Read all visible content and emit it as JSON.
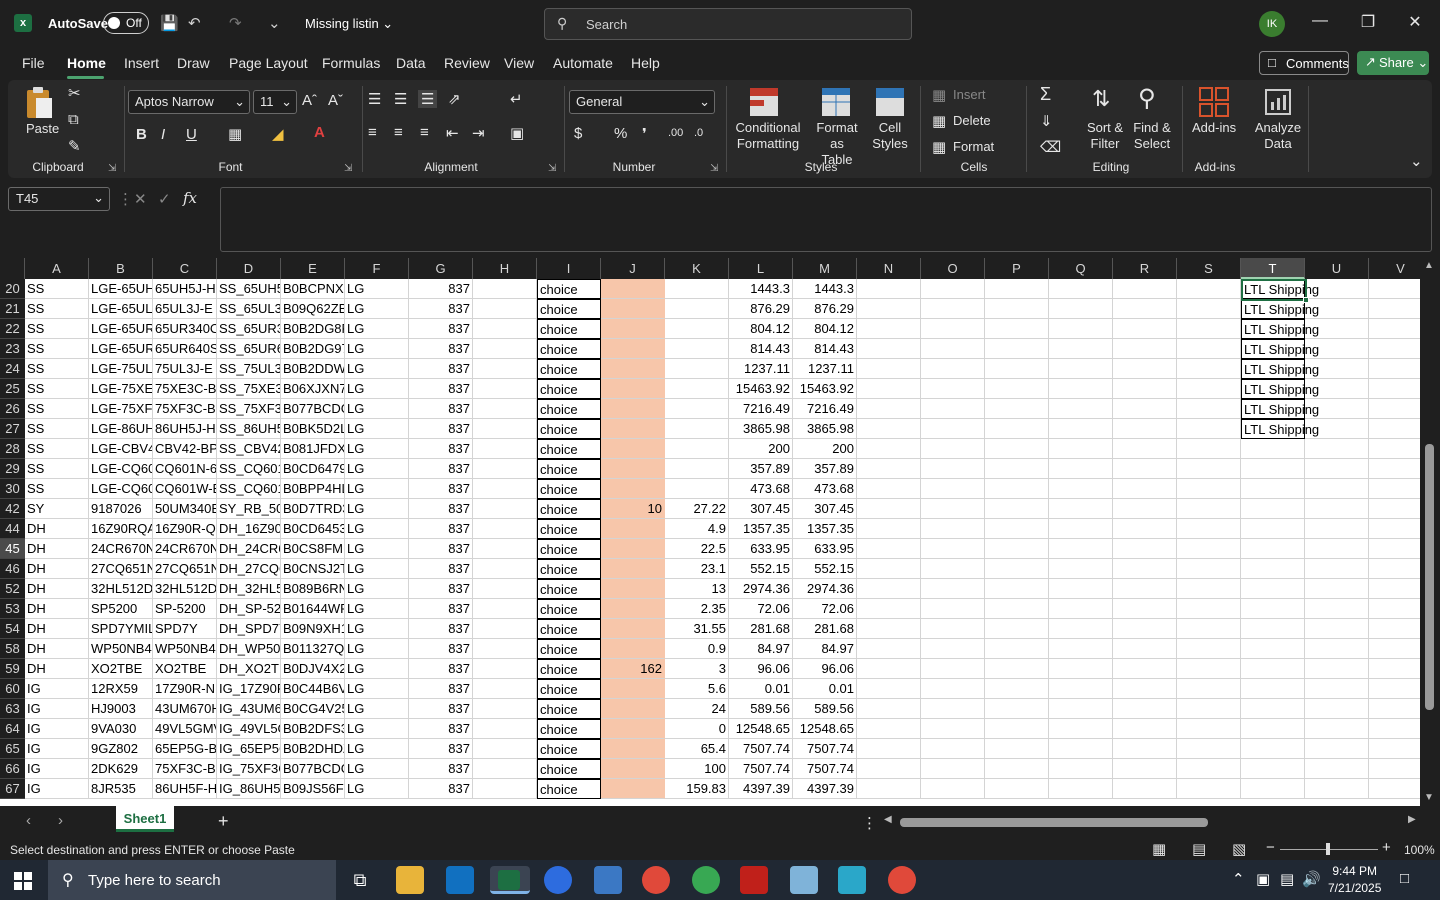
{
  "titlebar": {
    "autosave_label": "AutoSave",
    "autosave_state": "Off",
    "document_title": "Missing listin",
    "search_placeholder": "Search",
    "user_initials": "IK"
  },
  "menu": {
    "tabs": [
      "File",
      "Home",
      "Insert",
      "Draw",
      "Page Layout",
      "Formulas",
      "Data",
      "Review",
      "View",
      "Automate",
      "Help"
    ],
    "active": "Home",
    "comments_label": "Comments",
    "share_label": "Share"
  },
  "ribbon": {
    "clipboard": {
      "paste": "Paste",
      "group": "Clipboard"
    },
    "font": {
      "family": "Aptos Narrow",
      "size": "11",
      "group": "Font",
      "bold": "B",
      "italic": "I",
      "underline": "U"
    },
    "alignment": {
      "group": "Alignment"
    },
    "number": {
      "format": "General",
      "group": "Number"
    },
    "styles": {
      "conditional": "Conditional\nFormatting",
      "format_table": "Format as\nTable",
      "cell_styles": "Cell\nStyles",
      "group": "Styles"
    },
    "cells": {
      "insert": "Insert",
      "delete": "Delete",
      "format": "Format",
      "group": "Cells"
    },
    "editing": {
      "sort_filter": "Sort &\nFilter",
      "find_select": "Find &\nSelect",
      "group": "Editing"
    },
    "addins": {
      "addins": "Add-ins",
      "analyze": "Analyze\nData",
      "group": "Add-ins"
    }
  },
  "formula_bar": {
    "name_box": "T45",
    "fx": "fx",
    "value": ""
  },
  "columns": [
    "A",
    "B",
    "C",
    "D",
    "E",
    "F",
    "G",
    "H",
    "I",
    "J",
    "K",
    "L",
    "M",
    "N",
    "O",
    "P",
    "Q",
    "R",
    "S",
    "T",
    "U",
    "V"
  ],
  "selected_column": "T",
  "selected_row": "45",
  "rows": [
    {
      "n": "20",
      "A": "SS",
      "B": "LGE-65UH5",
      "C": "65UH5J-H",
      "D": "SS_65UH5.",
      "E": "B0BCPNXN",
      "F": "LG",
      "G": "837",
      "I": "choice",
      "J": "",
      "K": "",
      "L": "1443.3",
      "M": "1443.3",
      "T": "LTL Shipping"
    },
    {
      "n": "21",
      "A": "SS",
      "B": "LGE-65UL3",
      "C": "65UL3J-E",
      "D": "SS_65UL3J",
      "E": "B09Q62ZB",
      "F": "LG",
      "G": "837",
      "I": "choice",
      "J": "",
      "K": "",
      "L": "876.29",
      "M": "876.29",
      "T": "LTL Shipping"
    },
    {
      "n": "22",
      "A": "SS",
      "B": "LGE-65UR3",
      "C": "65UR340C",
      "D": "SS_65UR34",
      "E": "B0B2DG8P",
      "F": "LG",
      "G": "837",
      "I": "choice",
      "J": "",
      "K": "",
      "L": "804.12",
      "M": "804.12",
      "T": "LTL Shipping"
    },
    {
      "n": "23",
      "A": "SS",
      "B": "LGE-65UR6",
      "C": "65UR640S",
      "D": "SS_65UR64",
      "E": "B0B2DG97",
      "F": "LG",
      "G": "837",
      "I": "choice",
      "J": "",
      "K": "",
      "L": "814.43",
      "M": "814.43",
      "T": "LTL Shipping"
    },
    {
      "n": "24",
      "A": "SS",
      "B": "LGE-75UL3",
      "C": "75UL3J-E",
      "D": "SS_75UL3J",
      "E": "B0B2DDW",
      "F": "LG",
      "G": "837",
      "I": "choice",
      "J": "",
      "K": "",
      "L": "1237.11",
      "M": "1237.11",
      "T": "LTL Shipping"
    },
    {
      "n": "25",
      "A": "SS",
      "B": "LGE-75XE3",
      "C": "75XE3C-B",
      "D": "SS_75XE3C",
      "E": "B06XJXN7",
      "F": "LG",
      "G": "837",
      "I": "choice",
      "J": "",
      "K": "",
      "L": "15463.92",
      "M": "15463.92",
      "T": "LTL Shipping"
    },
    {
      "n": "26",
      "A": "SS",
      "B": "LGE-75XF3",
      "C": "75XF3C-B",
      "D": "SS_75XF3C",
      "E": "B077BCDG",
      "F": "LG",
      "G": "837",
      "I": "choice",
      "J": "",
      "K": "",
      "L": "7216.49",
      "M": "7216.49",
      "T": "LTL Shipping"
    },
    {
      "n": "27",
      "A": "SS",
      "B": "LGE-86UH5",
      "C": "86UH5J-H",
      "D": "SS_86UH5.",
      "E": "B0BK5D2L",
      "F": "LG",
      "G": "837",
      "I": "choice",
      "J": "",
      "K": "",
      "L": "3865.98",
      "M": "3865.98",
      "T": "LTL Shipping"
    },
    {
      "n": "28",
      "A": "SS",
      "B": "LGE-CBV42",
      "C": "CBV42-BP",
      "D": "SS_CBV42-",
      "E": "B081JFDXS",
      "F": "LG",
      "G": "837",
      "I": "choice",
      "J": "",
      "K": "",
      "L": "200",
      "M": "200",
      "T": ""
    },
    {
      "n": "29",
      "A": "SS",
      "B": "LGE-CQ60",
      "C": "CQ601N-6",
      "D": "SS_CQ601",
      "E": "B0CD6479",
      "F": "LG",
      "G": "837",
      "I": "choice",
      "J": "",
      "K": "",
      "L": "357.89",
      "M": "357.89",
      "T": ""
    },
    {
      "n": "30",
      "A": "SS",
      "B": "LGE-CQ60",
      "C": "CQ601W-E",
      "D": "SS_CQ601",
      "E": "B0BPP4HL",
      "F": "LG",
      "G": "837",
      "I": "choice",
      "J": "",
      "K": "",
      "L": "473.68",
      "M": "473.68",
      "T": ""
    },
    {
      "n": "42",
      "A": "SY",
      "B": "9187026",
      "C": "50UM340E",
      "D": "SY_RB_50L",
      "E": "B0D7TRD3",
      "F": "LG",
      "G": "837",
      "I": "choice",
      "J": "10",
      "K": "27.22",
      "L": "307.45",
      "M": "307.45",
      "T": ""
    },
    {
      "n": "44",
      "A": "DH",
      "B": "16Z90RQA",
      "C": "16Z90R-Q.",
      "D": "DH_16Z90I",
      "E": "B0CD6453",
      "F": "LG",
      "G": "837",
      "I": "choice",
      "J": "",
      "K": "4.9",
      "L": "1357.35",
      "M": "1357.35",
      "T": ""
    },
    {
      "n": "45",
      "A": "DH",
      "B": "24CR670N",
      "C": "24CR670N",
      "D": "DH_24CR6",
      "E": "B0CS8FM",
      "F": "LG",
      "G": "837",
      "I": "choice",
      "J": "",
      "K": "22.5",
      "L": "633.95",
      "M": "633.95",
      "T": ""
    },
    {
      "n": "46",
      "A": "DH",
      "B": "27CQ651N",
      "C": "27CQ651N",
      "D": "DH_27CQ6",
      "E": "B0CNSJ2T",
      "F": "LG",
      "G": "837",
      "I": "choice",
      "J": "",
      "K": "23.1",
      "L": "552.15",
      "M": "552.15",
      "T": ""
    },
    {
      "n": "52",
      "A": "DH",
      "B": "32HL512D",
      "C": "32HL512D-",
      "D": "DH_32HL5",
      "E": "B089B6RN",
      "F": "LG",
      "G": "837",
      "I": "choice",
      "J": "",
      "K": "13",
      "L": "2974.36",
      "M": "2974.36",
      "T": ""
    },
    {
      "n": "53",
      "A": "DH",
      "B": "SP5200",
      "C": "SP-5200",
      "D": "DH_SP-52(",
      "E": "B01644WF",
      "F": "LG",
      "G": "837",
      "I": "choice",
      "J": "",
      "K": "2.35",
      "L": "72.06",
      "M": "72.06",
      "T": ""
    },
    {
      "n": "54",
      "A": "DH",
      "B": "SPD7YMIL",
      "C": "SPD7Y",
      "D": "DH_SPD7Y",
      "E": "B09N9XH1",
      "F": "LG",
      "G": "837",
      "I": "choice",
      "J": "",
      "K": "31.55",
      "L": "281.68",
      "M": "281.68",
      "T": ""
    },
    {
      "n": "58",
      "A": "DH",
      "B": "WP50NB4(",
      "C": "WP50NB4(",
      "D": "DH_WP50I",
      "E": "B011327Q",
      "F": "LG",
      "G": "837",
      "I": "choice",
      "J": "",
      "K": "0.9",
      "L": "84.97",
      "M": "84.97",
      "T": ""
    },
    {
      "n": "59",
      "A": "DH",
      "B": "XO2TBE",
      "C": "XO2TBE",
      "D": "DH_XO2TE",
      "E": "B0DJV4X2",
      "F": "LG",
      "G": "837",
      "I": "choice",
      "J": "162",
      "K": "3",
      "L": "96.06",
      "M": "96.06",
      "T": ""
    },
    {
      "n": "60",
      "A": "IG",
      "B": "12RX59",
      "C": "17Z90R-N.",
      "D": "IG_17Z90R",
      "E": "B0C44B6V",
      "F": "LG",
      "G": "837",
      "I": "choice",
      "J": "",
      "K": "5.6",
      "L": "0.01",
      "M": "0.01",
      "T": ""
    },
    {
      "n": "63",
      "A": "IG",
      "B": "HJ9003",
      "C": "43UM670H",
      "D": "IG_43UM6",
      "E": "B0CG4V25",
      "F": "LG",
      "G": "837",
      "I": "choice",
      "J": "",
      "K": "24",
      "L": "589.56",
      "M": "589.56",
      "T": ""
    },
    {
      "n": "64",
      "A": "IG",
      "B": "9VA030",
      "C": "49VL5GMV",
      "D": "IG_49VL5G",
      "E": "B0B2DFS3",
      "F": "LG",
      "G": "837",
      "I": "choice",
      "J": "",
      "K": "0",
      "L": "12548.65",
      "M": "12548.65",
      "T": ""
    },
    {
      "n": "65",
      "A": "IG",
      "B": "9GZ802",
      "C": "65EP5G-B",
      "D": "IG_65EP5C",
      "E": "B0B2DHDZ",
      "F": "LG",
      "G": "837",
      "I": "choice",
      "J": "",
      "K": "65.4",
      "L": "7507.74",
      "M": "7507.74",
      "T": ""
    },
    {
      "n": "66",
      "A": "IG",
      "B": "2DK629",
      "C": "75XF3C-B",
      "D": "IG_75XF3C",
      "E": "B077BCDG",
      "F": "LG",
      "G": "837",
      "I": "choice",
      "J": "",
      "K": "100",
      "L": "7507.74",
      "M": "7507.74",
      "T": ""
    },
    {
      "n": "67",
      "A": "IG",
      "B": "8JR535",
      "C": "86UH5F-H",
      "D": "IG_86UH5I",
      "E": "B09JS56F4",
      "F": "LG",
      "G": "837",
      "I": "choice",
      "J": "",
      "K": "159.83",
      "L": "4397.39",
      "M": "4397.39",
      "T": ""
    }
  ],
  "sheet_tabs": {
    "active": "Sheet1",
    "add": "+"
  },
  "status": {
    "message": "Select destination and press ENTER or choose Paste",
    "zoom": "100%"
  },
  "taskbar": {
    "search_placeholder": "Type here to search",
    "time": "9:44 PM",
    "date": "7/21/2025"
  },
  "colors": {
    "accent": "#1d6f42",
    "peach": "#f7c6aa",
    "share": "#3c8a53"
  }
}
